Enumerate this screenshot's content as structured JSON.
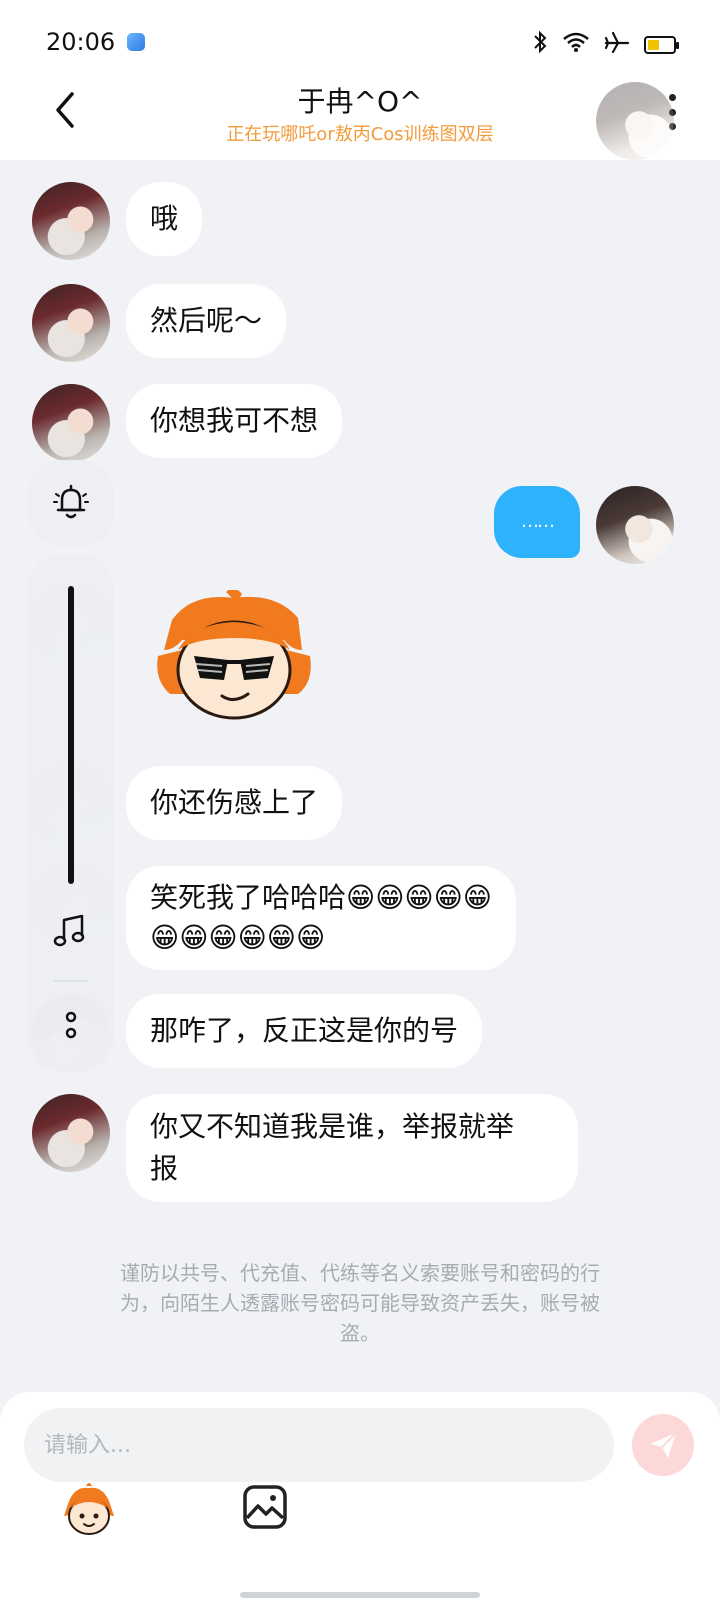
{
  "status_bar": {
    "time": "20:06",
    "icons": [
      "app-icon",
      "bluetooth-icon",
      "wifi-icon",
      "airplane-icon",
      "battery-icon"
    ],
    "battery_level": 0.45,
    "battery_color": "#f2c200"
  },
  "header": {
    "title": "于冉^O^",
    "subtitle": "正在玩哪吒or敖丙Cos训练图双层",
    "subtitle_color": "#f29b3a"
  },
  "messages": [
    {
      "side": "received",
      "text": "哦"
    },
    {
      "side": "received",
      "text": "然后呢～"
    },
    {
      "side": "received",
      "text": "你想我可不想"
    },
    {
      "side": "sent",
      "text": "……"
    },
    {
      "side": "received",
      "type": "sticker",
      "sticker": "cool-sunglasses-sticker"
    },
    {
      "side": "received",
      "text": "你还伤感上了"
    },
    {
      "side": "received",
      "line1": "笑死我了哈哈哈😁😁😁😁😁",
      "line2": "😁😁😁😁😁😁"
    },
    {
      "side": "received",
      "text": "那咋了，反正这是你的号"
    },
    {
      "side": "received",
      "line1": "你又不知道我是谁，举报就举",
      "line2": "报"
    }
  ],
  "floating_toolbar": {
    "icons": [
      "bell-icon",
      "music-note-icon",
      "more-dots-icon"
    ]
  },
  "notice": {
    "line1": "谨防以共号、代充值、代练等名义索要账号和密码的行",
    "line2": "为，向陌生人透露账号密码可能导致资产丢失，账号被",
    "line3": "盗。"
  },
  "input": {
    "placeholder": "请输入...",
    "value": ""
  },
  "toolbar": {
    "icons": [
      "sticker-icon",
      "image-icon"
    ]
  },
  "colors": {
    "sent_bubble": "#2eb2fb",
    "background": "#f0f2f6",
    "send_button": "#fcd8d8"
  }
}
